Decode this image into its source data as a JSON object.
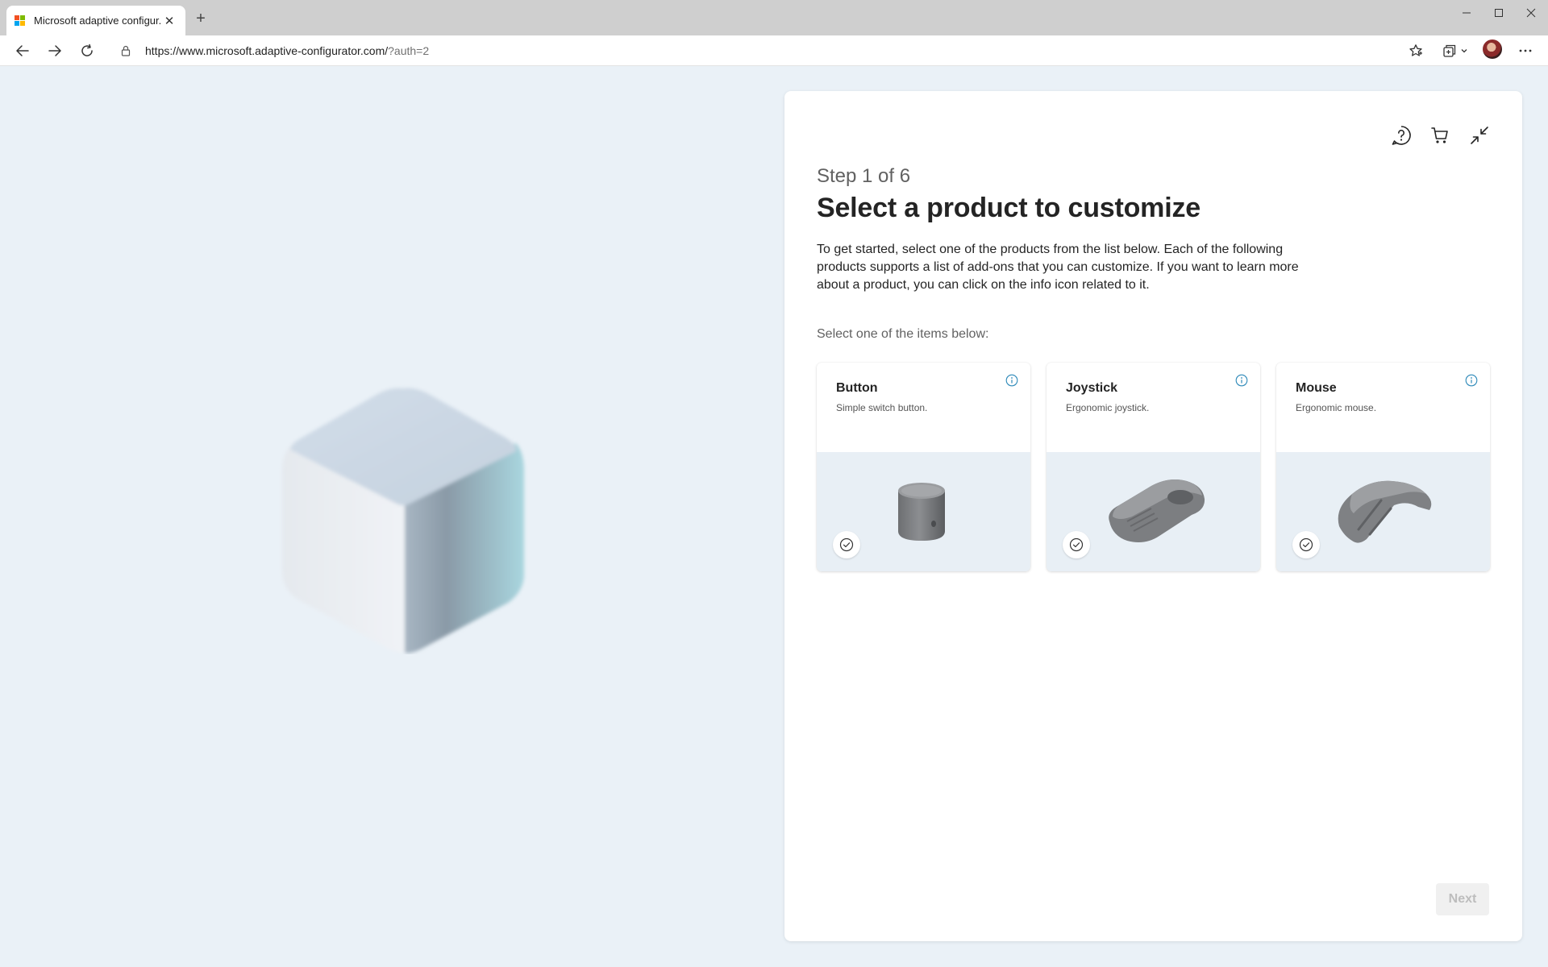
{
  "browser": {
    "tab_title": "Microsoft adaptive configur...",
    "url_main": "https://www.microsoft.adaptive-configurator.com/",
    "url_query": "?auth=2",
    "icons": [
      "back-icon",
      "forward-icon",
      "refresh-icon",
      "lock-icon",
      "favorite-icon",
      "collections-icon",
      "chevron-down-icon",
      "more-icon"
    ]
  },
  "panel": {
    "step": "Step 1 of 6",
    "title": "Select a product to customize",
    "description": "To get started, select one of the products from the list below. Each of the following products supports a list of add-ons that you can customize. If you want to learn more about a product, you can click on the info icon related to it.",
    "select_label": "Select one of the items below:",
    "icons": [
      "help-icon",
      "cart-icon",
      "collapse-icon"
    ],
    "products": [
      {
        "name": "Button",
        "subtitle": "Simple switch button."
      },
      {
        "name": "Joystick",
        "subtitle": "Ergonomic joystick."
      },
      {
        "name": "Mouse",
        "subtitle": "Ergonomic mouse."
      }
    ],
    "next_label": "Next"
  },
  "colors": {
    "background": "#eaf1f7",
    "card_image_bg": "#e8eff5",
    "info_icon": "#2b88b8",
    "next_disabled_bg": "#f0f0f0",
    "next_disabled_text": "#bdbdbd"
  }
}
